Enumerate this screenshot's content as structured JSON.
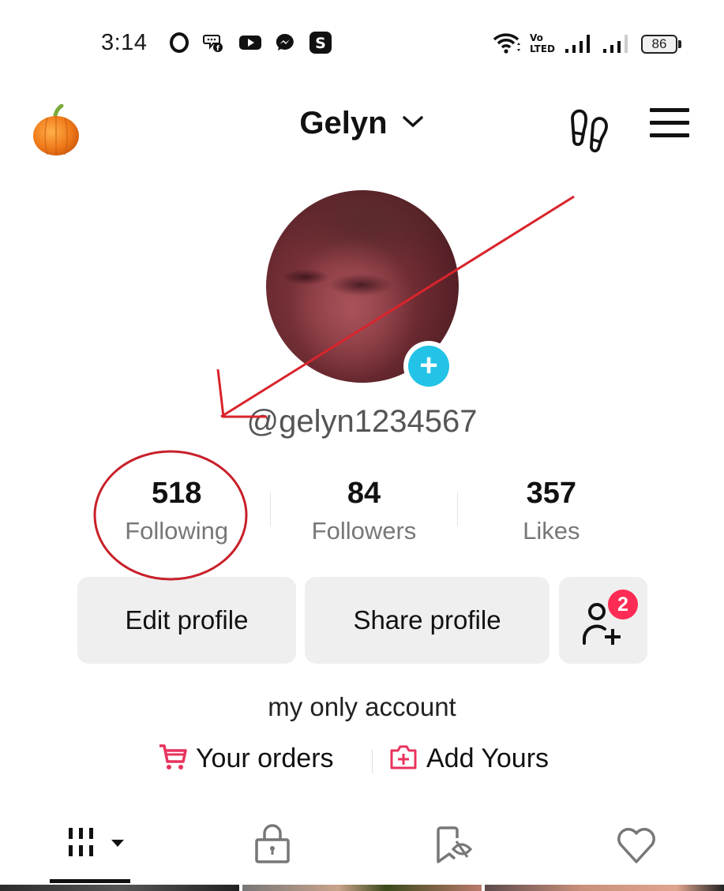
{
  "status_bar": {
    "time": "3:14",
    "app_icons": [
      "opera-icon",
      "facebook-messenger-chat-icon",
      "youtube-icon",
      "messenger-icon",
      "skype-icon"
    ],
    "network": [
      "wifi-icon",
      "volte-icon",
      "signal-icon",
      "signal-icon"
    ],
    "battery": "86"
  },
  "header": {
    "title": "Gelyn",
    "left_icon": "pumpkin-icon",
    "right_icons": [
      "footprint-icon",
      "menu-icon"
    ]
  },
  "profile": {
    "handle": "@gelyn1234567",
    "avatar_action": "+"
  },
  "stats": [
    {
      "value": "518",
      "label": "Following"
    },
    {
      "value": "84",
      "label": "Followers"
    },
    {
      "value": "357",
      "label": "Likes"
    }
  ],
  "buttons": {
    "edit": "Edit profile",
    "share": "Share profile",
    "add_friends_badge": "2"
  },
  "bio": "my only account",
  "links": {
    "orders": "Your orders",
    "add_yours": "Add Yours"
  },
  "tabs": [
    {
      "icon": "grid-icon",
      "active": true
    },
    {
      "icon": "lock-icon",
      "active": false
    },
    {
      "icon": "bookmark-hidden-icon",
      "active": false
    },
    {
      "icon": "heart-icon",
      "active": false
    }
  ],
  "colors": {
    "accent_pink": "#fe2c55",
    "avatar_plus": "#22c3e6",
    "annotation_red": "#d9242c"
  }
}
